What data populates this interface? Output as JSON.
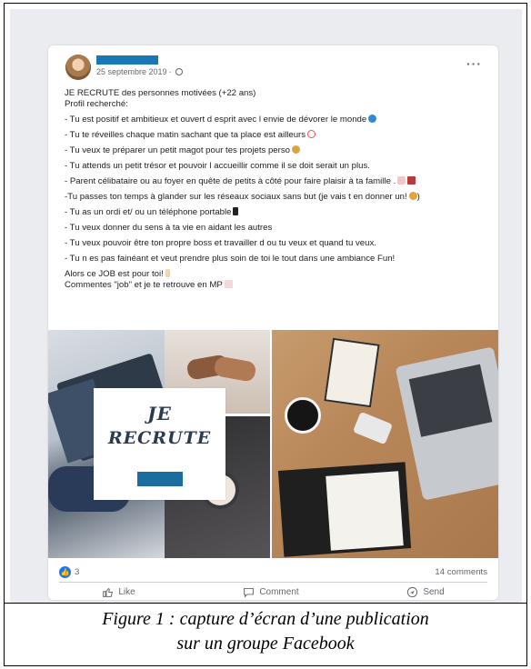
{
  "post": {
    "author_name": "",
    "date": "25 septembre 2019",
    "date_separator": "·",
    "more_label": "···",
    "lines": [
      "JE RECRUTE des personnes motivées (+22 ans)",
      "Profil recherché:",
      "- Tu est positif et ambitieux et ouvert d esprit  avec l envie de dévorer le monde",
      "- Tu te réveilles chaque matin sachant que ta place est ailleurs",
      "- Tu veux te préparer un petit magot pour tes projets perso",
      "- Tu attends un petit trésor et pouvoir l accueillir comme il se doit serait un plus.",
      "- Parent célibataire ou au foyer en quête de petits à côté pour faire plaisir à ta famille .",
      "-Tu passes ton temps à glander sur les réseaux sociaux sans but (je vais t en donner un!",
      "- Tu as un ordi et/ ou un téléphone portable",
      "- Tu veux donner du sens à ta vie en aidant les autres",
      "- Tu veux pouvoir être ton propre boss et travailler d ou tu veux et quand tu veux.",
      "- Tu n es pas fainéant et veut prendre plus soin de toi le tout dans une ambiance Fun!",
      "Alors ce JOB est pour toi!",
      "Commentes \"job\" et je te retrouve en MP"
    ],
    "line7_tail": ")",
    "image_banner": {
      "line1": "JE",
      "line2": "RECRUTE"
    },
    "reactions_count": "3",
    "comments_count": "14 comments",
    "actions": {
      "like": "Like",
      "comment": "Comment",
      "send": "Send"
    }
  },
  "caption": {
    "line1": "Figure 1 : capture d’écran d’une publication",
    "line2": "sur un groupe Facebook"
  },
  "colors": {
    "facebook_blue": "#1877f2",
    "name_redaction": "#1877b4",
    "banner_text": "#2b3a4e"
  },
  "icons": [
    "globe-icon",
    "more-icon",
    "earth-emoji-icon",
    "alarm-clock-emoji-icon",
    "money-bag-emoji-icon",
    "baby-bottle-emoji-icon",
    "gift-emoji-icon",
    "person-emoji-icon",
    "phone-emoji-icon",
    "hand-emoji-icon",
    "envelope-emoji-icon",
    "thumbs-up-icon",
    "comment-icon",
    "send-icon"
  ]
}
